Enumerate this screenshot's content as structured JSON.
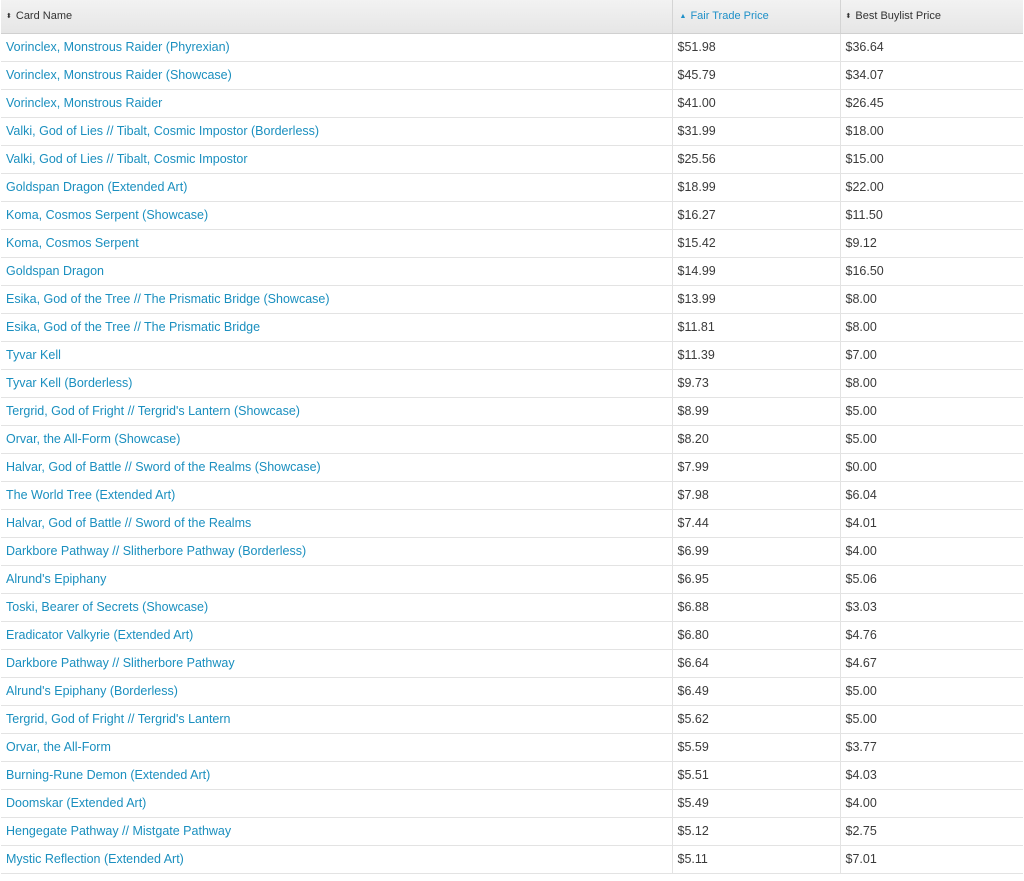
{
  "header": {
    "name_label": "Card Name",
    "fair_label": "Fair Trade Price",
    "buylist_label": "Best Buylist Price",
    "sort_both_glyph": "⬍",
    "sort_asc_glyph": "▲",
    "accent_color": "#1e90c8",
    "link_color": "#1a8fbf"
  },
  "rows": [
    {
      "name": "Vorinclex, Monstrous Raider (Phyrexian)",
      "fair": "$51.98",
      "buylist": "$36.64"
    },
    {
      "name": "Vorinclex, Monstrous Raider (Showcase)",
      "fair": "$45.79",
      "buylist": "$34.07"
    },
    {
      "name": "Vorinclex, Monstrous Raider",
      "fair": "$41.00",
      "buylist": "$26.45"
    },
    {
      "name": "Valki, God of Lies // Tibalt, Cosmic Impostor (Borderless)",
      "fair": "$31.99",
      "buylist": "$18.00"
    },
    {
      "name": "Valki, God of Lies // Tibalt, Cosmic Impostor",
      "fair": "$25.56",
      "buylist": "$15.00"
    },
    {
      "name": "Goldspan Dragon (Extended Art)",
      "fair": "$18.99",
      "buylist": "$22.00"
    },
    {
      "name": "Koma, Cosmos Serpent (Showcase)",
      "fair": "$16.27",
      "buylist": "$11.50"
    },
    {
      "name": "Koma, Cosmos Serpent",
      "fair": "$15.42",
      "buylist": "$9.12"
    },
    {
      "name": "Goldspan Dragon",
      "fair": "$14.99",
      "buylist": "$16.50"
    },
    {
      "name": "Esika, God of the Tree // The Prismatic Bridge (Showcase)",
      "fair": "$13.99",
      "buylist": "$8.00"
    },
    {
      "name": "Esika, God of the Tree // The Prismatic Bridge",
      "fair": "$11.81",
      "buylist": "$8.00"
    },
    {
      "name": "Tyvar Kell",
      "fair": "$11.39",
      "buylist": "$7.00"
    },
    {
      "name": "Tyvar Kell (Borderless)",
      "fair": "$9.73",
      "buylist": "$8.00"
    },
    {
      "name": "Tergrid, God of Fright // Tergrid's Lantern (Showcase)",
      "fair": "$8.99",
      "buylist": "$5.00"
    },
    {
      "name": "Orvar, the All-Form (Showcase)",
      "fair": "$8.20",
      "buylist": "$5.00"
    },
    {
      "name": "Halvar, God of Battle // Sword of the Realms (Showcase)",
      "fair": "$7.99",
      "buylist": "$0.00"
    },
    {
      "name": "The World Tree (Extended Art)",
      "fair": "$7.98",
      "buylist": "$6.04"
    },
    {
      "name": "Halvar, God of Battle // Sword of the Realms",
      "fair": "$7.44",
      "buylist": "$4.01"
    },
    {
      "name": "Darkbore Pathway // Slitherbore Pathway (Borderless)",
      "fair": "$6.99",
      "buylist": "$4.00"
    },
    {
      "name": "Alrund's Epiphany",
      "fair": "$6.95",
      "buylist": "$5.06"
    },
    {
      "name": "Toski, Bearer of Secrets (Showcase)",
      "fair": "$6.88",
      "buylist": "$3.03"
    },
    {
      "name": "Eradicator Valkyrie (Extended Art)",
      "fair": "$6.80",
      "buylist": "$4.76"
    },
    {
      "name": "Darkbore Pathway // Slitherbore Pathway",
      "fair": "$6.64",
      "buylist": "$4.67"
    },
    {
      "name": "Alrund's Epiphany (Borderless)",
      "fair": "$6.49",
      "buylist": "$5.00"
    },
    {
      "name": "Tergrid, God of Fright // Tergrid's Lantern",
      "fair": "$5.62",
      "buylist": "$5.00"
    },
    {
      "name": "Orvar, the All-Form",
      "fair": "$5.59",
      "buylist": "$3.77"
    },
    {
      "name": "Burning-Rune Demon (Extended Art)",
      "fair": "$5.51",
      "buylist": "$4.03"
    },
    {
      "name": "Doomskar (Extended Art)",
      "fair": "$5.49",
      "buylist": "$4.00"
    },
    {
      "name": "Hengegate Pathway // Mistgate Pathway",
      "fair": "$5.12",
      "buylist": "$2.75"
    },
    {
      "name": "Mystic Reflection (Extended Art)",
      "fair": "$5.11",
      "buylist": "$7.01"
    }
  ]
}
